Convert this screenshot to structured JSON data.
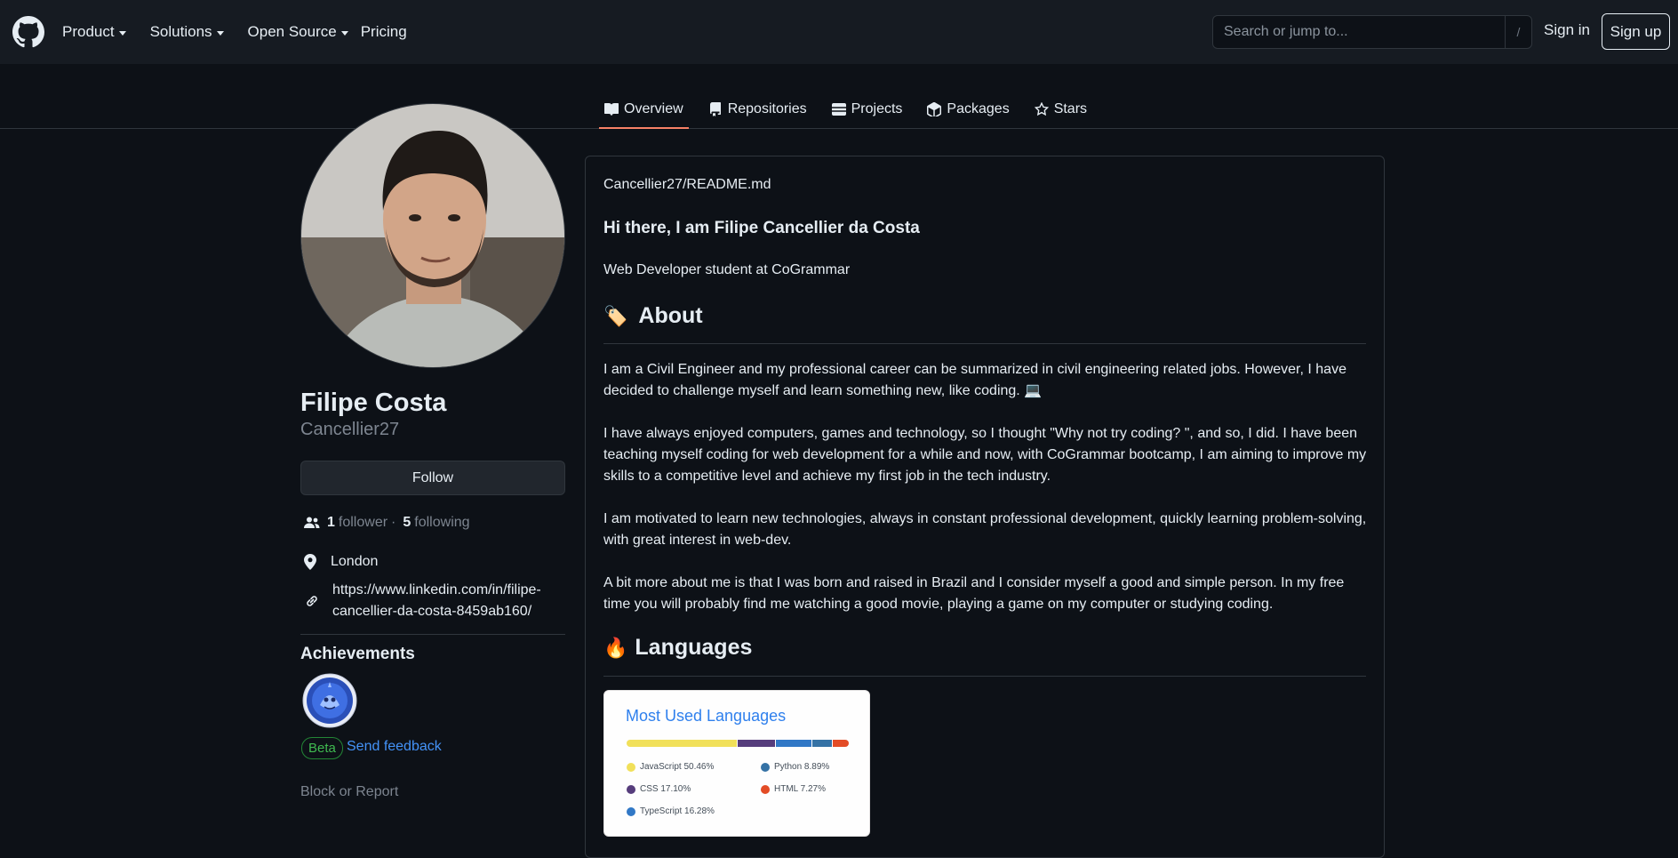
{
  "header": {
    "nav": [
      {
        "label": "Product",
        "caret": true
      },
      {
        "label": "Solutions",
        "caret": true
      },
      {
        "label": "Open Source",
        "caret": true
      },
      {
        "label": "Pricing",
        "caret": false
      }
    ],
    "search_placeholder": "Search or jump to...",
    "search_shortcut": "/",
    "sign_in": "Sign in",
    "sign_up": "Sign up"
  },
  "tabs": [
    {
      "label": "Overview",
      "icon": "book-icon",
      "active": true
    },
    {
      "label": "Repositories",
      "icon": "repo-icon",
      "active": false
    },
    {
      "label": "Projects",
      "icon": "table-icon",
      "active": false
    },
    {
      "label": "Packages",
      "icon": "package-icon",
      "active": false
    },
    {
      "label": "Stars",
      "icon": "star-icon",
      "active": false
    }
  ],
  "profile": {
    "name": "Filipe Costa",
    "login": "Cancellier27",
    "follow_label": "Follow",
    "followers_count": "1",
    "followers_label": "follower",
    "separator": "·",
    "following_count": "5",
    "following_label": "following",
    "location": "London",
    "website": "https://www.linkedin.com/in/filipe-cancellier-da-costa-8459ab160/",
    "achievements_title": "Achievements",
    "beta_label": "Beta",
    "feedback_label": "Send feedback",
    "block_label": "Block or Report"
  },
  "readme": {
    "file": "Cancellier27/README.md",
    "greeting": "Hi there, I am Filipe Cancellier da Costa",
    "subtitle": "Web Developer student at CoGrammar",
    "about_emoji": "🏷️",
    "about_title": "About",
    "paragraphs": [
      "I am a Civil Engineer and my professional career can be summarized in civil engineering related jobs. However, I have decided to challenge myself and learn something new, like coding. 💻",
      "I have always enjoyed computers, games and technology, so I thought \"Why not try coding? \", and so, I did. I have been teaching myself coding for web development for a while and now, with CoGrammar bootcamp, I am aiming to improve my skills to a competitive level and achieve my first job in the tech industry.",
      "I am motivated to learn new technologies, always in constant professional development, quickly learning problem-solving, with great interest in web-dev.",
      "A bit more about me is that I was born and raised in Brazil and I consider myself a good and simple person. In my free time you will probably find me watching a good movie, playing a game on my computer or studying coding."
    ],
    "languages_emoji": "🔥",
    "languages_title": "Languages"
  },
  "languages_card": {
    "title": "Most Used Languages",
    "items": [
      {
        "name": "JavaScript",
        "percent": 50.46,
        "label": "JavaScript 50.46%",
        "color": "#f1e05a"
      },
      {
        "name": "CSS",
        "percent": 17.1,
        "label": "CSS 17.10%",
        "color": "#563d7c"
      },
      {
        "name": "TypeScript",
        "percent": 16.28,
        "label": "TypeScript 16.28%",
        "color": "#3178c6"
      },
      {
        "name": "Python",
        "percent": 8.89,
        "label": "Python 8.89%",
        "color": "#3572a5"
      },
      {
        "name": "HTML",
        "percent": 7.27,
        "label": "HTML 7.27%",
        "color": "#e34c26"
      }
    ]
  },
  "colors": {
    "page_bg": "#0d1117",
    "header_bg": "#161b22",
    "border": "#30363d",
    "link": "#4493f8",
    "active_tab": "#f78166"
  }
}
